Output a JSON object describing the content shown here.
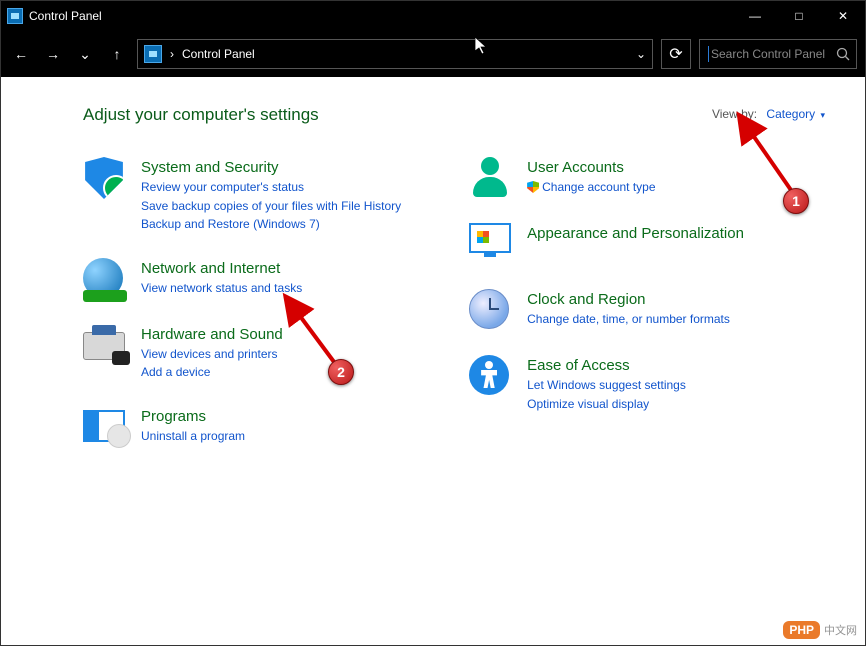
{
  "window": {
    "title": "Control Panel",
    "minimize": "—",
    "maximize": "□",
    "close": "✕"
  },
  "nav": {
    "back": "←",
    "forward": "→",
    "dropdown": "⌄",
    "up": "↑",
    "breadcrumb_sep": "›",
    "breadcrumb": "Control Panel",
    "expand": "⌄",
    "refresh": "⟳"
  },
  "search": {
    "placeholder": "Search Control Panel"
  },
  "page": {
    "heading": "Adjust your computer's settings",
    "viewby_label": "View by:",
    "viewby_value": "Category",
    "viewby_caret": "▾"
  },
  "left_items": [
    {
      "key": "system-security",
      "title": "System and Security",
      "links": [
        "Review your computer's status",
        "Save backup copies of your files with File History",
        "Backup and Restore (Windows 7)"
      ]
    },
    {
      "key": "network-internet",
      "title": "Network and Internet",
      "links": [
        "View network status and tasks"
      ]
    },
    {
      "key": "hardware-sound",
      "title": "Hardware and Sound",
      "links": [
        "View devices and printers",
        "Add a device"
      ]
    },
    {
      "key": "programs",
      "title": "Programs",
      "links": [
        "Uninstall a program"
      ]
    }
  ],
  "right_items": [
    {
      "key": "user-accounts",
      "title": "User Accounts",
      "links": [
        "Change account type"
      ],
      "shield": [
        true
      ]
    },
    {
      "key": "appearance-personalization",
      "title": "Appearance and Personalization",
      "links": []
    },
    {
      "key": "clock-region",
      "title": "Clock and Region",
      "links": [
        "Change date, time, or number formats"
      ]
    },
    {
      "key": "ease-of-access",
      "title": "Ease of Access",
      "links": [
        "Let Windows suggest settings",
        "Optimize visual display"
      ]
    }
  ],
  "annotations": {
    "badge1": "1",
    "badge2": "2"
  },
  "watermark": {
    "a": "PHP",
    "b": "中文网"
  }
}
